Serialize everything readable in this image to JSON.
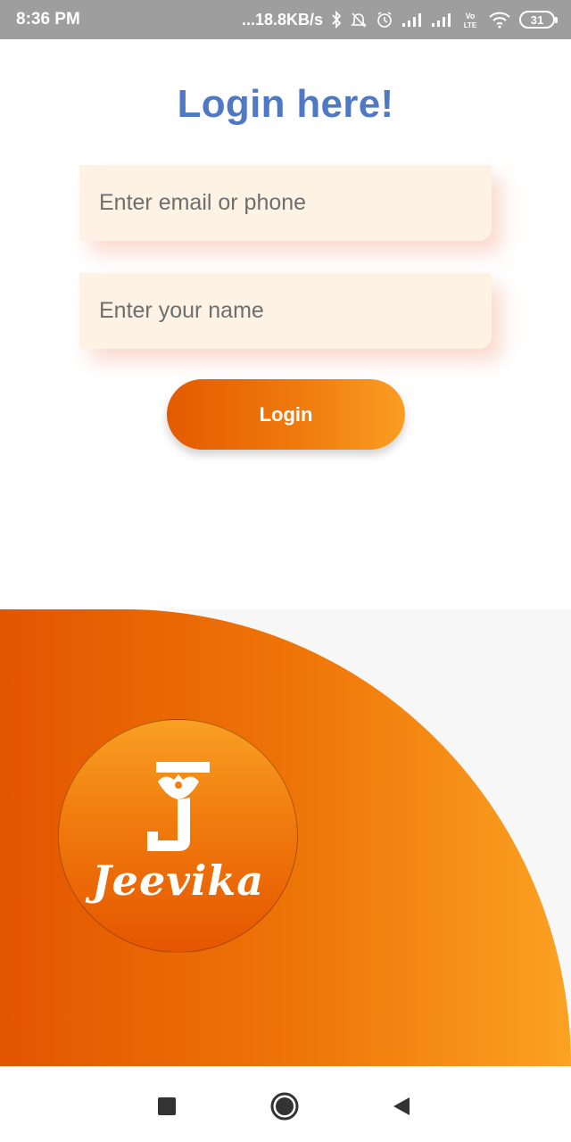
{
  "status_bar": {
    "time": "8:36 PM",
    "network_speed": "...18.8KB/s",
    "battery": "31",
    "icons": [
      "bluetooth-icon",
      "mute-notification-icon",
      "alarm-icon",
      "signal-icon",
      "signal-icon",
      "volte-icon",
      "wifi-icon",
      "battery-icon"
    ]
  },
  "login": {
    "title": "Login here!",
    "email_placeholder": "Enter email or phone",
    "name_placeholder": "Enter your name",
    "button_label": "Login"
  },
  "brand": {
    "name": "Jeevika",
    "logo_letter": "J"
  },
  "nav": {
    "icons": [
      "recents-icon",
      "home-icon",
      "back-icon"
    ]
  },
  "colors": {
    "title": "#4f79c4",
    "accent_orange": "#e35500",
    "accent_orange_light": "#fba223",
    "field_bg": "#fdf2e4"
  }
}
